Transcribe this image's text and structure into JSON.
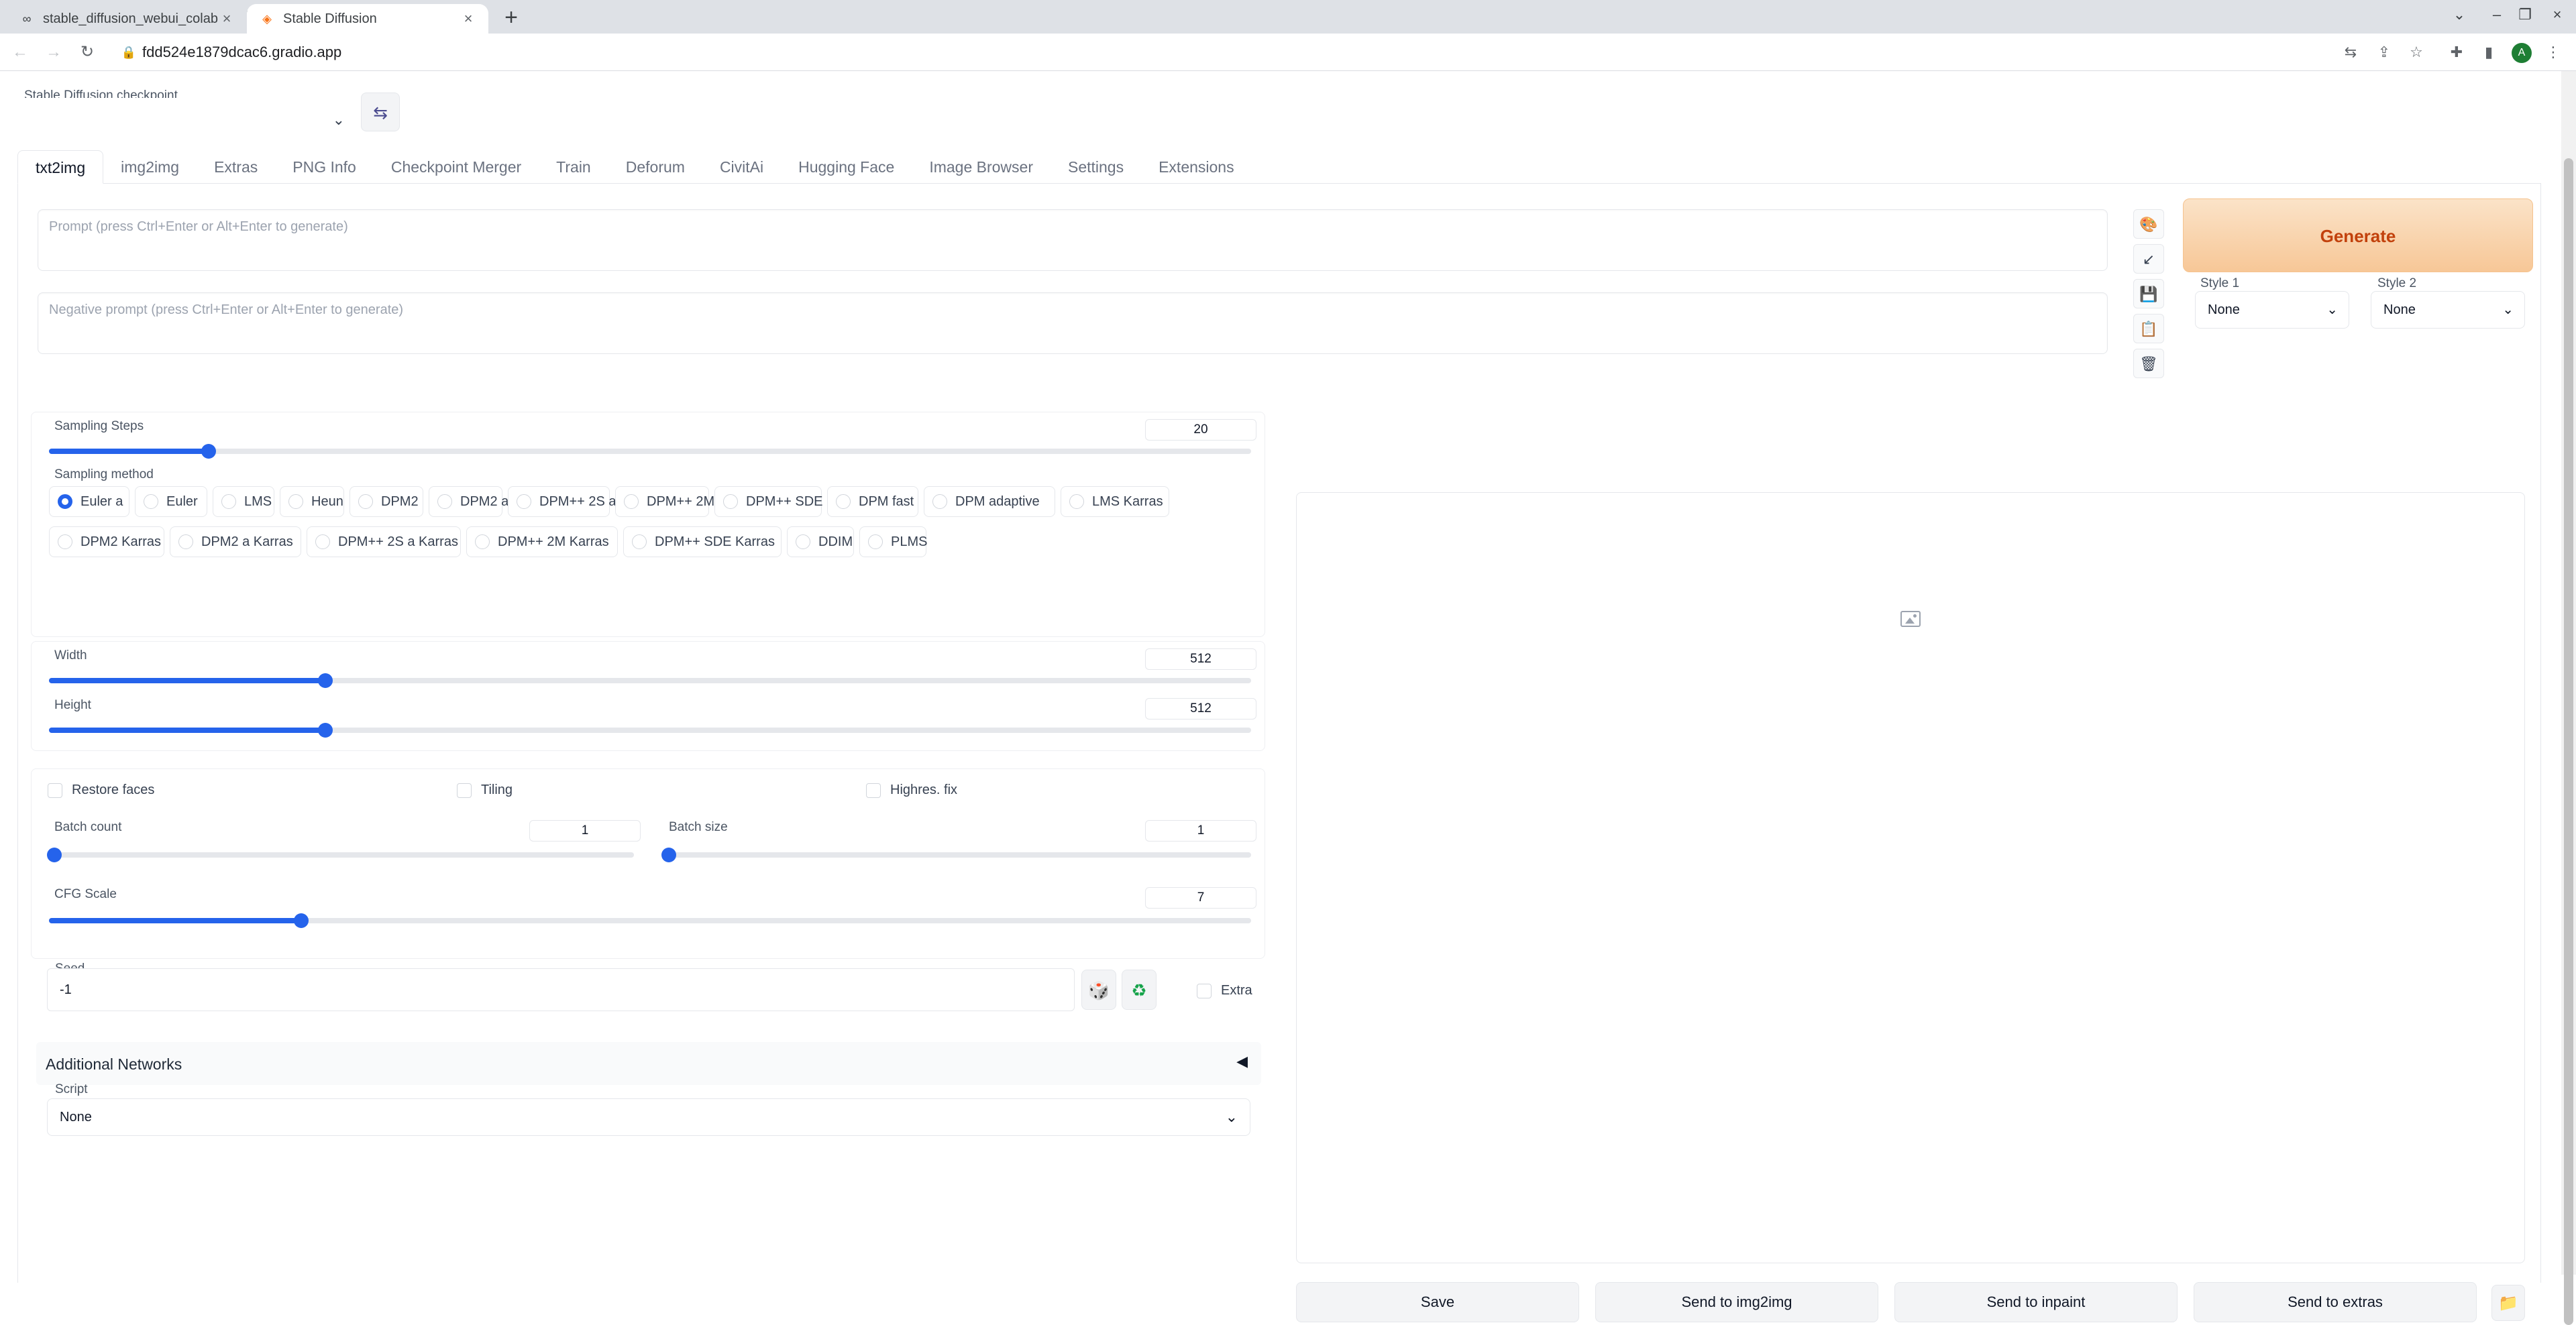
{
  "browser": {
    "tabs": [
      {
        "title": "stable_diffusion_webui_colab.i",
        "icon": "colab-icon",
        "active": false
      },
      {
        "title": "Stable Diffusion",
        "icon": "gradio-icon",
        "active": true
      }
    ],
    "url": "fdd524e1879dcac6.gradio.app",
    "profile_initial": "A"
  },
  "checkpoint": {
    "label": "Stable Diffusion checkpoint",
    "value": ""
  },
  "tabs": [
    "txt2img",
    "img2img",
    "Extras",
    "PNG Info",
    "Checkpoint Merger",
    "Train",
    "Deforum",
    "CivitAi",
    "Hugging Face",
    "Image Browser",
    "Settings",
    "Extensions"
  ],
  "prompt": {
    "placeholder": "Prompt (press Ctrl+Enter or Alt+Enter to generate)",
    "negative_placeholder": "Negative prompt (press Ctrl+Enter or Alt+Enter to generate)"
  },
  "generate_label": "Generate",
  "styles": [
    {
      "label": "Style 1",
      "value": "None"
    },
    {
      "label": "Style 2",
      "value": "None"
    }
  ],
  "sampling_steps": {
    "label": "Sampling Steps",
    "value": "20",
    "fraction": 0.133
  },
  "sampling_method": {
    "label": "Sampling method",
    "options": [
      "Euler a",
      "Euler",
      "LMS",
      "Heun",
      "DPM2",
      "DPM2 a",
      "DPM++ 2S a",
      "DPM++ 2M",
      "DPM++ SDE",
      "DPM fast",
      "DPM adaptive",
      "LMS Karras",
      "DPM2 Karras",
      "DPM2 a Karras",
      "DPM++ 2S a Karras",
      "DPM++ 2M Karras",
      "DPM++ SDE Karras",
      "DDIM",
      "PLMS"
    ],
    "selected": "Euler a"
  },
  "width": {
    "label": "Width",
    "value": "512",
    "fraction": 0.23
  },
  "height": {
    "label": "Height",
    "value": "512",
    "fraction": 0.23
  },
  "checkboxes": {
    "restore_faces": "Restore faces",
    "tiling": "Tiling",
    "highres_fix": "Highres. fix"
  },
  "batch_count": {
    "label": "Batch count",
    "value": "1",
    "fraction": 0
  },
  "batch_size": {
    "label": "Batch size",
    "value": "1",
    "fraction": 0
  },
  "cfg_scale": {
    "label": "CFG Scale",
    "value": "7",
    "fraction": 0.21
  },
  "seed": {
    "label": "Seed",
    "value": "-1",
    "extra_label": "Extra"
  },
  "additional_networks": {
    "title": "Additional Networks",
    "toggle": "◀"
  },
  "script": {
    "label": "Script",
    "value": "None"
  },
  "output_buttons": [
    "Save",
    "Send to img2img",
    "Send to inpaint",
    "Send to extras"
  ],
  "colors": {
    "accent": "#2563eb",
    "generate_bg": "#f7c797",
    "generate_text": "#c2410c"
  }
}
